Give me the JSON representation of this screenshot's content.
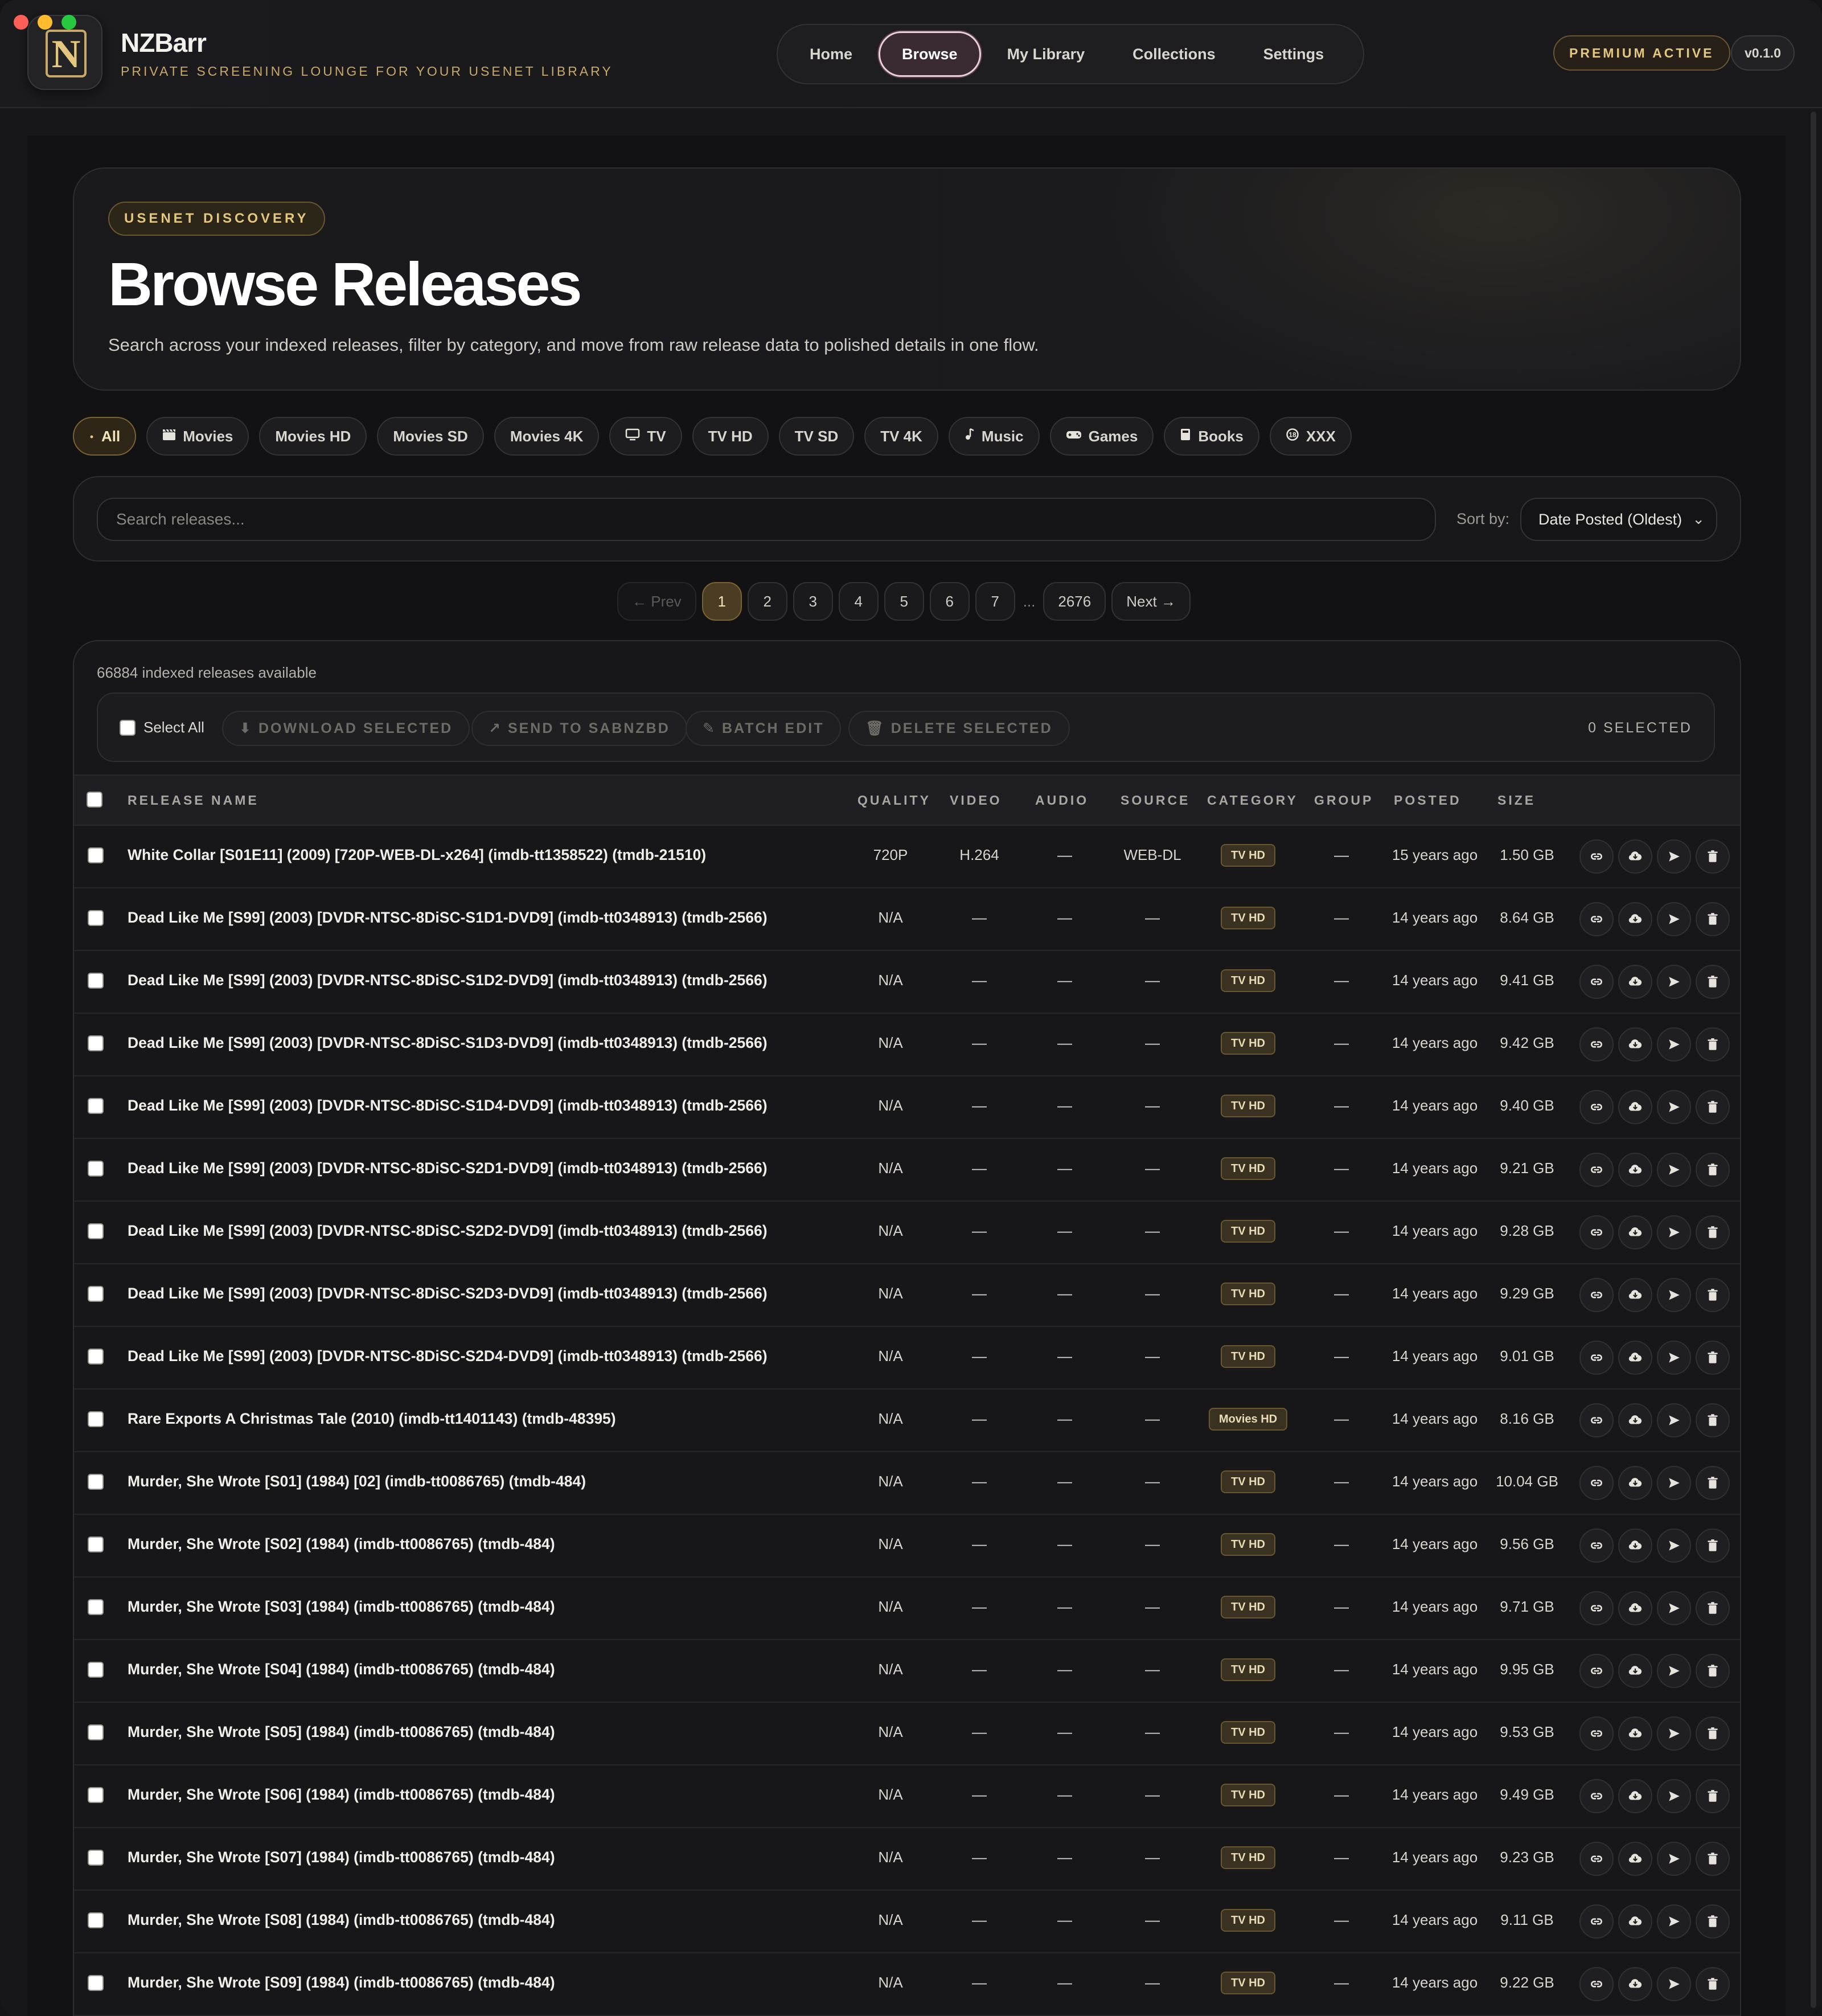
{
  "app": {
    "name": "NZBarr",
    "tagline": "PRIVATE SCREENING LOUNGE FOR YOUR USENET LIBRARY",
    "premium_badge": "PREMIUM ACTIVE",
    "version": "v0.1.0"
  },
  "nav": [
    {
      "label": "Home",
      "active": false
    },
    {
      "label": "Browse",
      "active": true
    },
    {
      "label": "My Library",
      "active": false
    },
    {
      "label": "Collections",
      "active": false
    },
    {
      "label": "Settings",
      "active": false
    }
  ],
  "hero": {
    "badge": "USENET DISCOVERY",
    "title": "Browse Releases",
    "description": "Search across your indexed releases, filter by category, and move from raw release data to polished details in one flow."
  },
  "categories": [
    {
      "label": "All",
      "icon": "dot-icon",
      "active": true
    },
    {
      "label": "Movies",
      "icon": "clapper-icon",
      "active": false
    },
    {
      "label": "Movies HD",
      "icon": "",
      "active": false
    },
    {
      "label": "Movies SD",
      "icon": "",
      "active": false
    },
    {
      "label": "Movies 4K",
      "icon": "",
      "active": false
    },
    {
      "label": "TV",
      "icon": "tv-icon",
      "active": false
    },
    {
      "label": "TV HD",
      "icon": "",
      "active": false
    },
    {
      "label": "TV SD",
      "icon": "",
      "active": false
    },
    {
      "label": "TV 4K",
      "icon": "",
      "active": false
    },
    {
      "label": "Music",
      "icon": "music-note-icon",
      "active": false
    },
    {
      "label": "Games",
      "icon": "gamepad-icon",
      "active": false
    },
    {
      "label": "Books",
      "icon": "book-icon",
      "active": false
    },
    {
      "label": "XXX",
      "icon": "restricted-icon",
      "active": false
    }
  ],
  "search": {
    "placeholder": "Search releases...",
    "value": "",
    "sort_label": "Sort by:",
    "sort_value": "Date Posted (Oldest)"
  },
  "pagination": {
    "prev": "← Prev",
    "pages": [
      "1",
      "2",
      "3",
      "4",
      "5",
      "6",
      "7"
    ],
    "current": "1",
    "ellipsis": "...",
    "last": "2676",
    "next": "Next →"
  },
  "results": {
    "count_text": "66884 indexed releases available",
    "select_all": "Select All",
    "bulk_actions": [
      {
        "label": "DOWNLOAD SELECTED",
        "icon": "download-icon"
      },
      {
        "label": "SEND TO SABNZBD",
        "icon": "arrow-up-right-icon"
      },
      {
        "label": "BATCH EDIT",
        "icon": "pencil-icon"
      },
      {
        "label": "DELETE SELECTED",
        "icon": "trash-icon"
      }
    ],
    "selected_text": "0 SELECTED"
  },
  "table": {
    "headers": {
      "name": "RELEASE NAME",
      "quality": "QUALITY",
      "video": "VIDEO",
      "audio": "AUDIO",
      "source": "SOURCE",
      "category": "CATEGORY",
      "group": "GROUP",
      "posted": "POSTED",
      "size": "SIZE"
    },
    "rows": [
      {
        "name": "White Collar [S01E11] (2009) [720P-WEB-DL-x264] (imdb-tt1358522) (tmdb-21510)",
        "quality": "720P",
        "video": "H.264",
        "audio": "—",
        "source": "WEB-DL",
        "category": "TV HD",
        "group": "—",
        "posted": "15 years ago",
        "size": "1.50 GB"
      },
      {
        "name": "Dead Like Me [S99] (2003) [DVDR-NTSC-8DiSC-S1D1-DVD9] (imdb-tt0348913) (tmdb-2566)",
        "quality": "N/A",
        "video": "—",
        "audio": "—",
        "source": "—",
        "category": "TV HD",
        "group": "—",
        "posted": "14 years ago",
        "size": "8.64 GB"
      },
      {
        "name": "Dead Like Me [S99] (2003) [DVDR-NTSC-8DiSC-S1D2-DVD9] (imdb-tt0348913) (tmdb-2566)",
        "quality": "N/A",
        "video": "—",
        "audio": "—",
        "source": "—",
        "category": "TV HD",
        "group": "—",
        "posted": "14 years ago",
        "size": "9.41 GB"
      },
      {
        "name": "Dead Like Me [S99] (2003) [DVDR-NTSC-8DiSC-S1D3-DVD9] (imdb-tt0348913) (tmdb-2566)",
        "quality": "N/A",
        "video": "—",
        "audio": "—",
        "source": "—",
        "category": "TV HD",
        "group": "—",
        "posted": "14 years ago",
        "size": "9.42 GB"
      },
      {
        "name": "Dead Like Me [S99] (2003) [DVDR-NTSC-8DiSC-S1D4-DVD9] (imdb-tt0348913) (tmdb-2566)",
        "quality": "N/A",
        "video": "—",
        "audio": "—",
        "source": "—",
        "category": "TV HD",
        "group": "—",
        "posted": "14 years ago",
        "size": "9.40 GB"
      },
      {
        "name": "Dead Like Me [S99] (2003) [DVDR-NTSC-8DiSC-S2D1-DVD9] (imdb-tt0348913) (tmdb-2566)",
        "quality": "N/A",
        "video": "—",
        "audio": "—",
        "source": "—",
        "category": "TV HD",
        "group": "—",
        "posted": "14 years ago",
        "size": "9.21 GB"
      },
      {
        "name": "Dead Like Me [S99] (2003) [DVDR-NTSC-8DiSC-S2D2-DVD9] (imdb-tt0348913) (tmdb-2566)",
        "quality": "N/A",
        "video": "—",
        "audio": "—",
        "source": "—",
        "category": "TV HD",
        "group": "—",
        "posted": "14 years ago",
        "size": "9.28 GB"
      },
      {
        "name": "Dead Like Me [S99] (2003) [DVDR-NTSC-8DiSC-S2D3-DVD9] (imdb-tt0348913) (tmdb-2566)",
        "quality": "N/A",
        "video": "—",
        "audio": "—",
        "source": "—",
        "category": "TV HD",
        "group": "—",
        "posted": "14 years ago",
        "size": "9.29 GB"
      },
      {
        "name": "Dead Like Me [S99] (2003) [DVDR-NTSC-8DiSC-S2D4-DVD9] (imdb-tt0348913) (tmdb-2566)",
        "quality": "N/A",
        "video": "—",
        "audio": "—",
        "source": "—",
        "category": "TV HD",
        "group": "—",
        "posted": "14 years ago",
        "size": "9.01 GB"
      },
      {
        "name": "Rare Exports A Christmas Tale (2010) (imdb-tt1401143) (tmdb-48395)",
        "quality": "N/A",
        "video": "—",
        "audio": "—",
        "source": "—",
        "category": "Movies HD",
        "group": "—",
        "posted": "14 years ago",
        "size": "8.16 GB"
      },
      {
        "name": "Murder, She Wrote [S01] (1984) [02] (imdb-tt0086765) (tmdb-484)",
        "quality": "N/A",
        "video": "—",
        "audio": "—",
        "source": "—",
        "category": "TV HD",
        "group": "—",
        "posted": "14 years ago",
        "size": "10.04 GB"
      },
      {
        "name": "Murder, She Wrote [S02] (1984) (imdb-tt0086765) (tmdb-484)",
        "quality": "N/A",
        "video": "—",
        "audio": "—",
        "source": "—",
        "category": "TV HD",
        "group": "—",
        "posted": "14 years ago",
        "size": "9.56 GB"
      },
      {
        "name": "Murder, She Wrote [S03] (1984) (imdb-tt0086765) (tmdb-484)",
        "quality": "N/A",
        "video": "—",
        "audio": "—",
        "source": "—",
        "category": "TV HD",
        "group": "—",
        "posted": "14 years ago",
        "size": "9.71 GB"
      },
      {
        "name": "Murder, She Wrote [S04] (1984) (imdb-tt0086765) (tmdb-484)",
        "quality": "N/A",
        "video": "—",
        "audio": "—",
        "source": "—",
        "category": "TV HD",
        "group": "—",
        "posted": "14 years ago",
        "size": "9.95 GB"
      },
      {
        "name": "Murder, She Wrote [S05] (1984) (imdb-tt0086765) (tmdb-484)",
        "quality": "N/A",
        "video": "—",
        "audio": "—",
        "source": "—",
        "category": "TV HD",
        "group": "—",
        "posted": "14 years ago",
        "size": "9.53 GB"
      },
      {
        "name": "Murder, She Wrote [S06] (1984) (imdb-tt0086765) (tmdb-484)",
        "quality": "N/A",
        "video": "—",
        "audio": "—",
        "source": "—",
        "category": "TV HD",
        "group": "—",
        "posted": "14 years ago",
        "size": "9.49 GB"
      },
      {
        "name": "Murder, She Wrote [S07] (1984) (imdb-tt0086765) (tmdb-484)",
        "quality": "N/A",
        "video": "—",
        "audio": "—",
        "source": "—",
        "category": "TV HD",
        "group": "—",
        "posted": "14 years ago",
        "size": "9.23 GB"
      },
      {
        "name": "Murder, She Wrote [S08] (1984) (imdb-tt0086765) (tmdb-484)",
        "quality": "N/A",
        "video": "—",
        "audio": "—",
        "source": "—",
        "category": "TV HD",
        "group": "—",
        "posted": "14 years ago",
        "size": "9.11 GB"
      },
      {
        "name": "Murder, She Wrote [S09] (1984) (imdb-tt0086765) (tmdb-484)",
        "quality": "N/A",
        "video": "—",
        "audio": "—",
        "source": "—",
        "category": "TV HD",
        "group": "—",
        "posted": "14 years ago",
        "size": "9.22 GB"
      }
    ],
    "row_actions": [
      "link-icon",
      "cloud-download-icon",
      "send-icon",
      "trash-icon"
    ]
  },
  "colors": {
    "accent_gold": "#e3c77f",
    "background": "#17171a",
    "active_nav_border": "#e8cfd9"
  }
}
